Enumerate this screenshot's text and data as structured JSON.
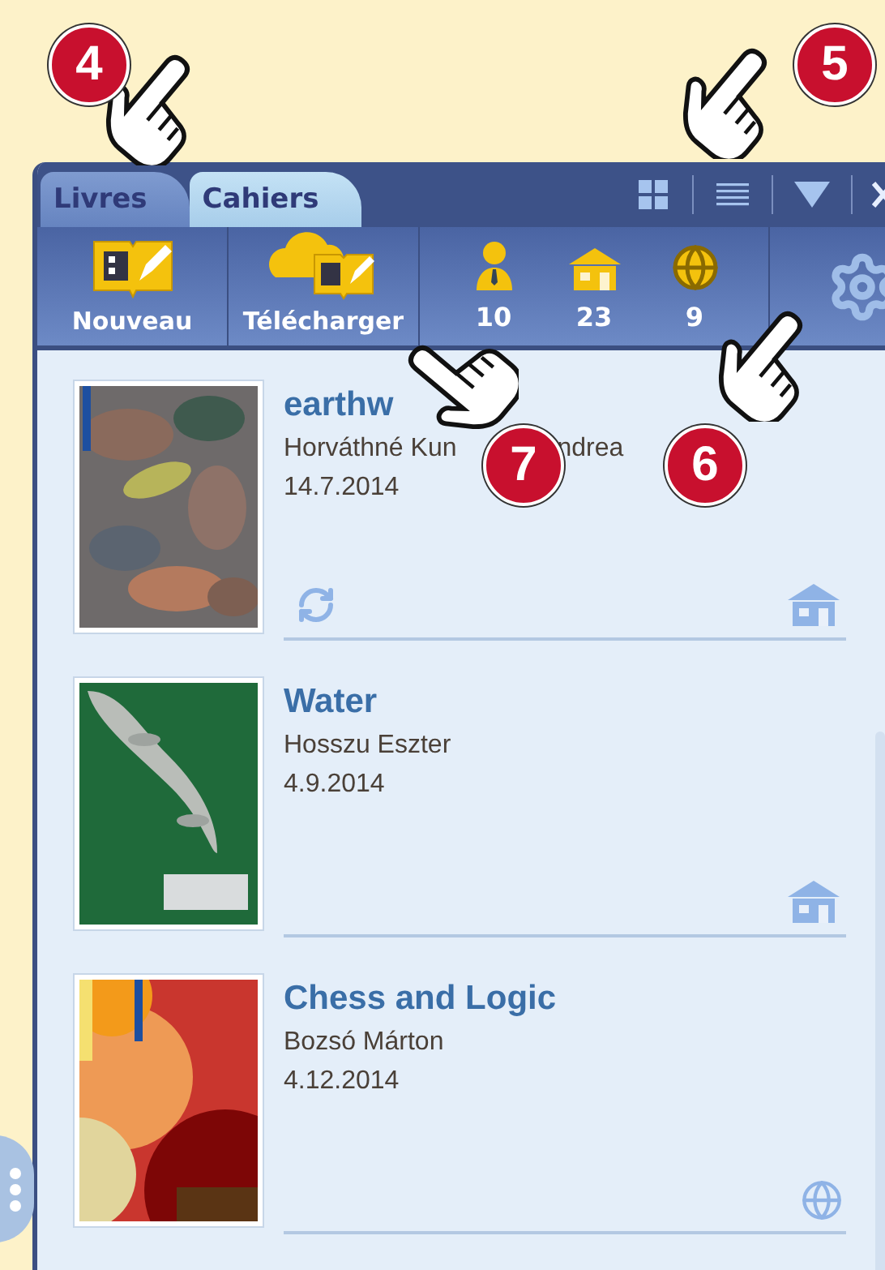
{
  "callouts": [
    {
      "number": "4"
    },
    {
      "number": "5"
    },
    {
      "number": "7"
    },
    {
      "number": "6"
    }
  ],
  "tabs": [
    {
      "label": "Livres",
      "selected": false
    },
    {
      "label": "Cahiers",
      "selected": true
    }
  ],
  "toolbar": {
    "buttons": [
      {
        "kind": "new",
        "label": "Nouveau"
      },
      {
        "kind": "download",
        "label": "Télécharger"
      }
    ],
    "stats": [
      {
        "kind": "person",
        "count": "10"
      },
      {
        "kind": "house",
        "count": "23"
      },
      {
        "kind": "globe",
        "count": "9"
      }
    ]
  },
  "books": [
    {
      "title": "earthw",
      "author": [
        "Horváthné Kun",
        "ndrea"
      ],
      "date": "14.7.2014",
      "sync": true,
      "access": {
        "kind": "house"
      }
    },
    {
      "title": "Water",
      "author": [
        "Hosszu Eszter"
      ],
      "date": "4.9.2014",
      "sync": false,
      "access": {
        "kind": "house"
      }
    },
    {
      "title": "Chess and Logic",
      "author": [
        "Bozsó Márton"
      ],
      "date": "4.12.2014",
      "sync": false,
      "access": {
        "kind": "globe"
      }
    }
  ]
}
